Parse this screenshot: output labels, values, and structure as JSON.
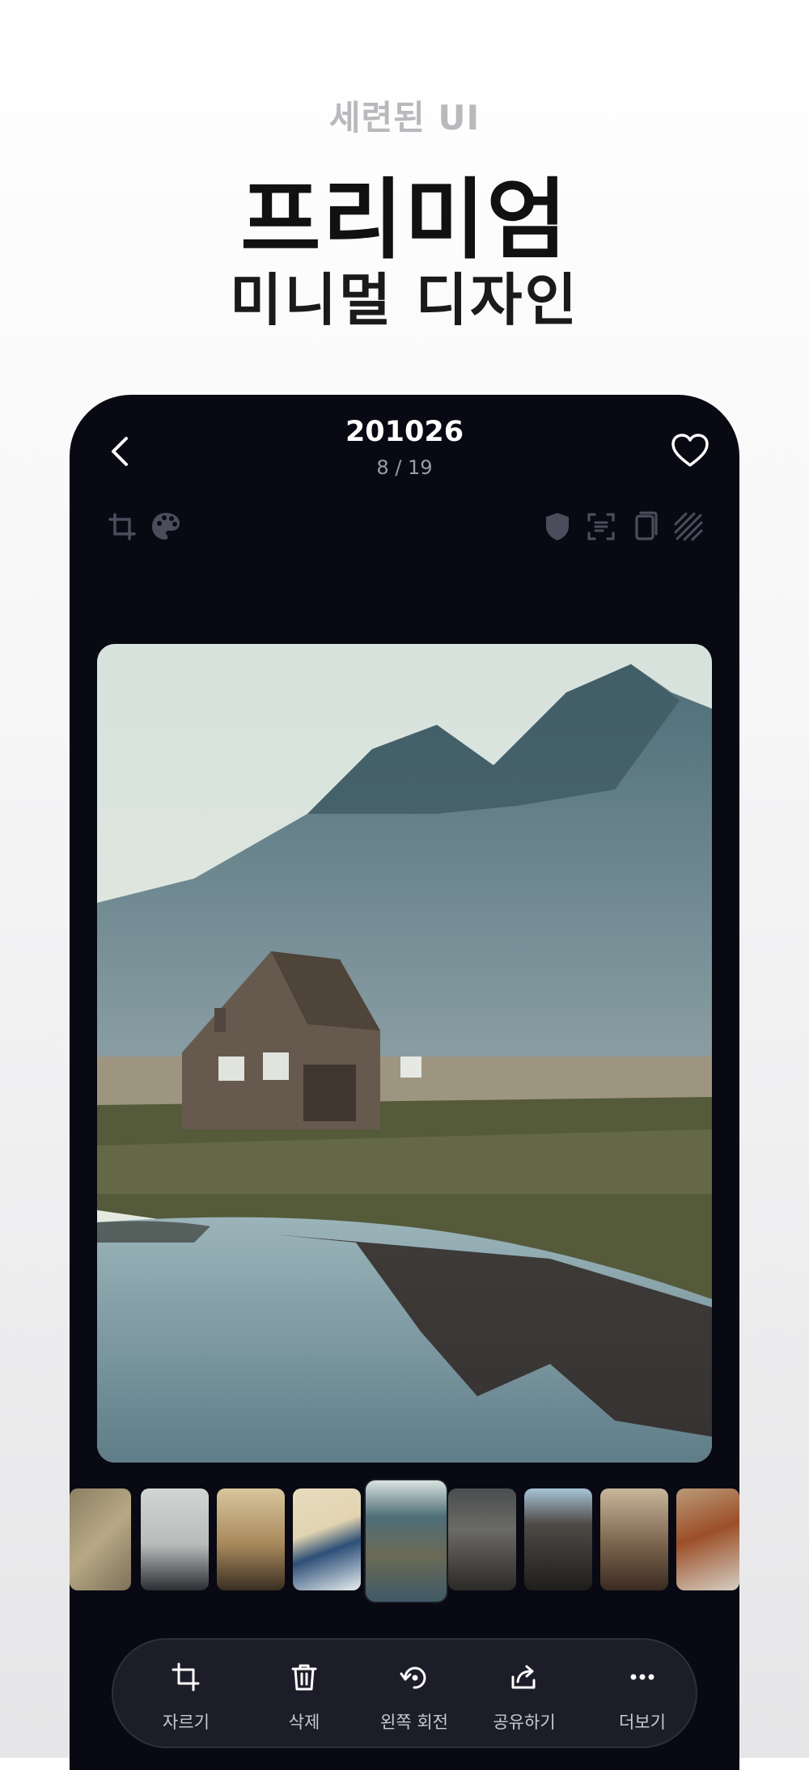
{
  "promo": {
    "subtitle": "세련된 UI",
    "title": "프리미엄",
    "tagline": "미니멀 디자인"
  },
  "viewer": {
    "title": "201026",
    "counter": "8 / 19",
    "icons": {
      "back": "chevron-left-icon",
      "favorite": "heart-icon",
      "tools_left": [
        "crop-icon",
        "palette-icon"
      ],
      "tools_right": [
        "shield-icon",
        "scan-text-icon",
        "copy-icon",
        "pattern-icon"
      ]
    }
  },
  "photo": {
    "subject": "mountain-cabin-reflection"
  },
  "filmstrip": {
    "count": 9,
    "active_index": 4
  },
  "actions": [
    {
      "label": "자르기",
      "icon": "crop-icon"
    },
    {
      "label": "삭제",
      "icon": "trash-icon"
    },
    {
      "label": "왼쪽 회전",
      "icon": "rotate-left-icon"
    },
    {
      "label": "공유하기",
      "icon": "share-icon"
    },
    {
      "label": "더보기",
      "icon": "more-icon"
    }
  ],
  "colors": {
    "background": "#080913",
    "action_bar": "#1c1d28",
    "text": "#ffffff",
    "muted": "#9a9ca8"
  }
}
